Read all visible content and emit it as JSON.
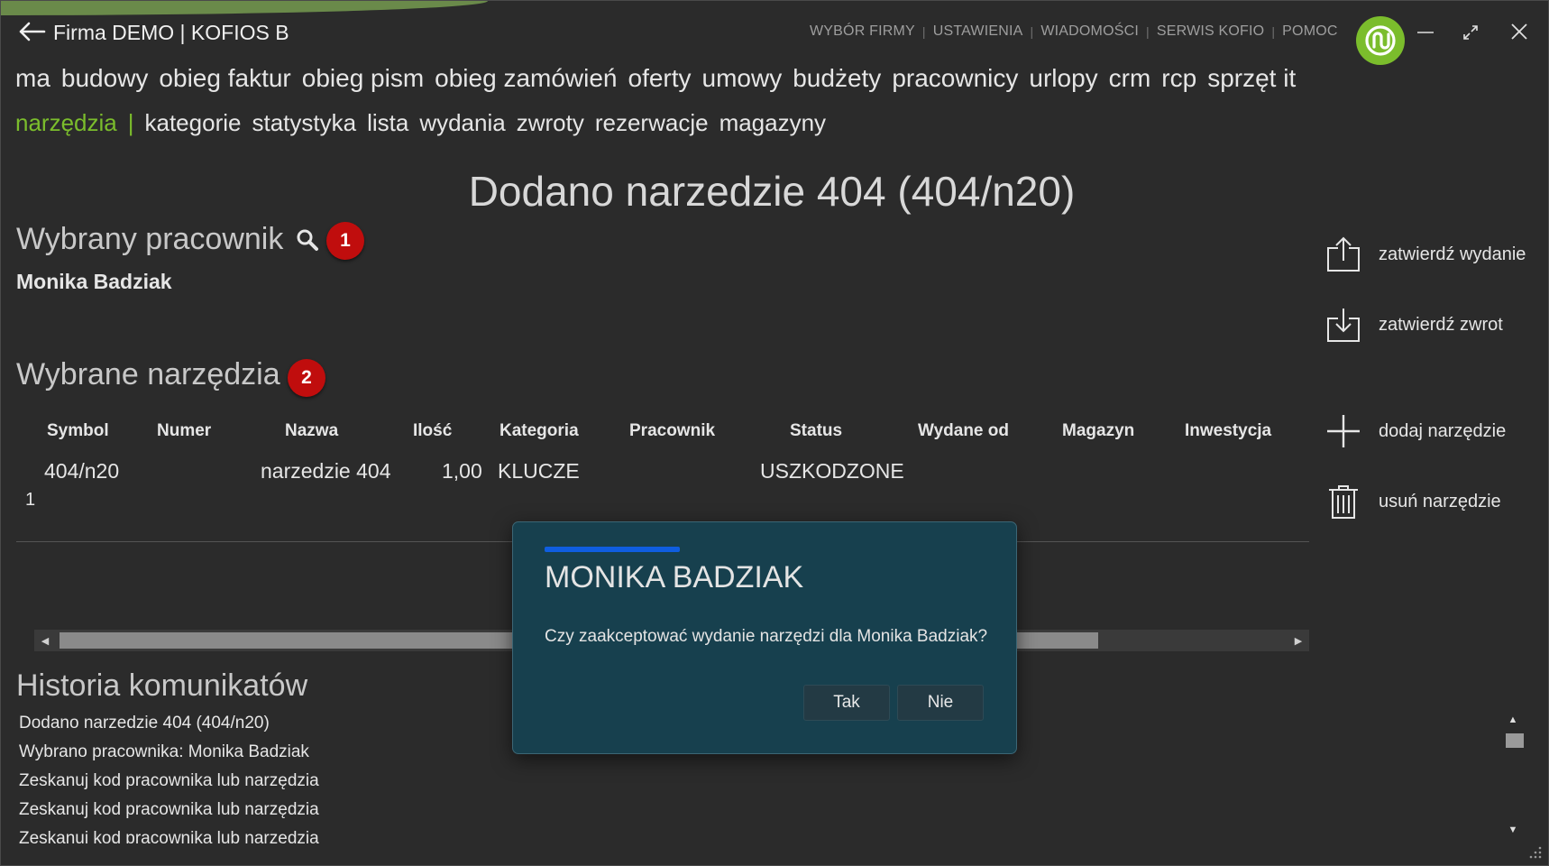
{
  "app": {
    "title": "Firma DEMO | KOFIOS B",
    "topnav": [
      "WYBÓR FIRMY",
      "USTAWIENIA",
      "WIADOMOŚCI",
      "SERWIS KOFIO",
      "POMOC"
    ],
    "topnav_separator": "|"
  },
  "nav": {
    "modules": [
      "ma",
      "budowy",
      "obieg faktur",
      "obieg pism",
      "obieg zamówień",
      "oferty",
      "umowy",
      "budżety",
      "pracownicy",
      "urlopy",
      "crm",
      "rcp",
      "sprzęt it"
    ],
    "current": "narzędzia",
    "separator": "|",
    "subitems": [
      "kategorie",
      "statystyka",
      "lista",
      "wydania",
      "zwroty",
      "rezerwacje",
      "magazyny"
    ]
  },
  "page": {
    "title": "Dodano narzedzie 404 (404/n20)"
  },
  "employee_section": {
    "heading": "Wybrany pracownik",
    "badge": "1",
    "employee_name": "Monika Badziak"
  },
  "tools_section": {
    "heading": "Wybrane narzędzia",
    "badge": "2",
    "columns": [
      "Symbol",
      "Numer",
      "Nazwa",
      "Ilość",
      "Kategoria",
      "Pracownik",
      "Status",
      "Wydane od",
      "Magazyn",
      "Inwestycja"
    ],
    "rows": [
      {
        "number": "1",
        "symbol": "404/n20",
        "numer": "",
        "nazwa": "narzedzie 404",
        "ilosc": "1,00",
        "kategoria": "KLUCZE",
        "pracownik": "",
        "status": "USZKODZONE",
        "wydane_od": "",
        "magazyn": "",
        "inwestycja": ""
      }
    ]
  },
  "actions": {
    "issue": "zatwierdź wydanie",
    "return": "zatwierdź zwrot",
    "add": "dodaj narzędzie",
    "remove": "usuń narzędzie"
  },
  "history": {
    "heading": "Historia komunikatów",
    "items": [
      "Dodano narzedzie 404 (404/n20)",
      "Wybrano pracownika: Monika Badziak",
      "Zeskanuj kod pracownika lub narzędzia",
      "Zeskanuj kod pracownika lub narzędzia",
      "Zeskanuj kod pracownika lub narzędzia"
    ]
  },
  "dialog": {
    "title": "MONIKA BADZIAK",
    "message": "Czy zaakceptować wydanie narzędzi dla Monika Badziak?",
    "yes_label": "Tak",
    "no_label": "Nie"
  },
  "colors": {
    "background": "#2b2b2b",
    "accent_green": "#7bbd2c",
    "badge_red": "#c00d0d",
    "dialog_bg": "#17404e",
    "dialog_progress": "#0f5ee0"
  },
  "icons": {
    "back": "arrow-left-icon",
    "logo": "kofio-logo-icon",
    "search": "magnifier-icon",
    "issue": "upload-tray-icon",
    "return": "download-tray-icon",
    "add": "plus-icon",
    "remove": "trash-icon"
  }
}
